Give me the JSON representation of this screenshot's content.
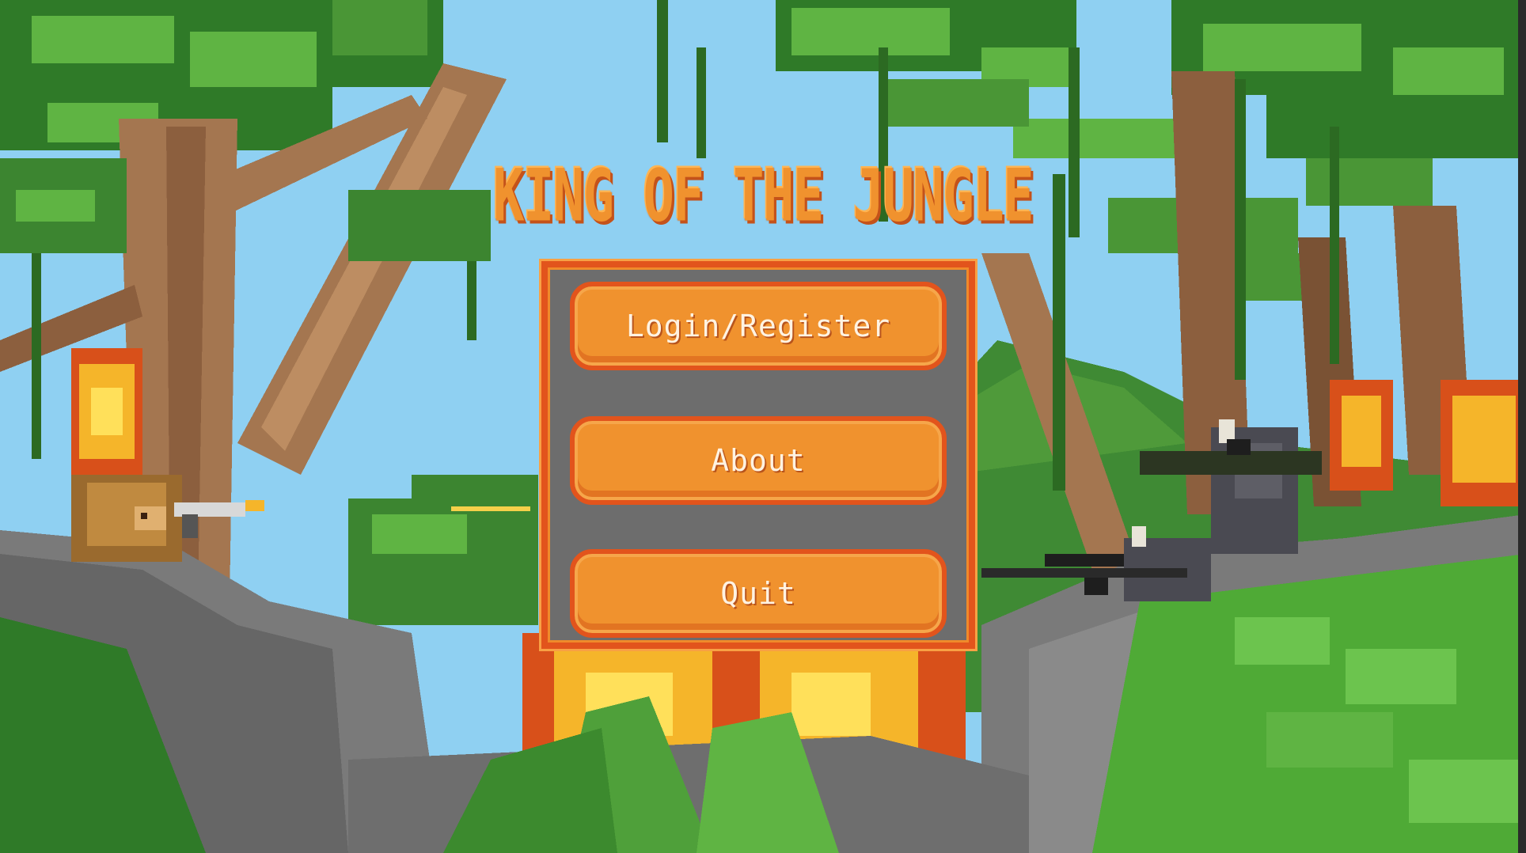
{
  "game": {
    "title": "KING OF THE JUNGLE"
  },
  "menu": {
    "buttons": [
      {
        "id": "login",
        "label": "Login/Register"
      },
      {
        "id": "about",
        "label": "About"
      },
      {
        "id": "quit",
        "label": "Quit"
      }
    ]
  },
  "colors": {
    "sky": "#8fd0f2",
    "accent_orange": "#f0922e",
    "border_red": "#e2541c",
    "panel_gray": "#6d6d6d",
    "foliage_dark": "#2f7a28",
    "foliage_light": "#5fb443",
    "trunk": "#a47650",
    "rock": "#7a7a7a",
    "fire": "#f5b52a"
  },
  "scene": {
    "characters": [
      "lion-with-pistol",
      "rhino-with-sniper-rifle",
      "rhino-with-rocket-launcher"
    ],
    "elements": [
      "jungle-trees",
      "vines",
      "fire",
      "rocks",
      "ferns"
    ]
  }
}
